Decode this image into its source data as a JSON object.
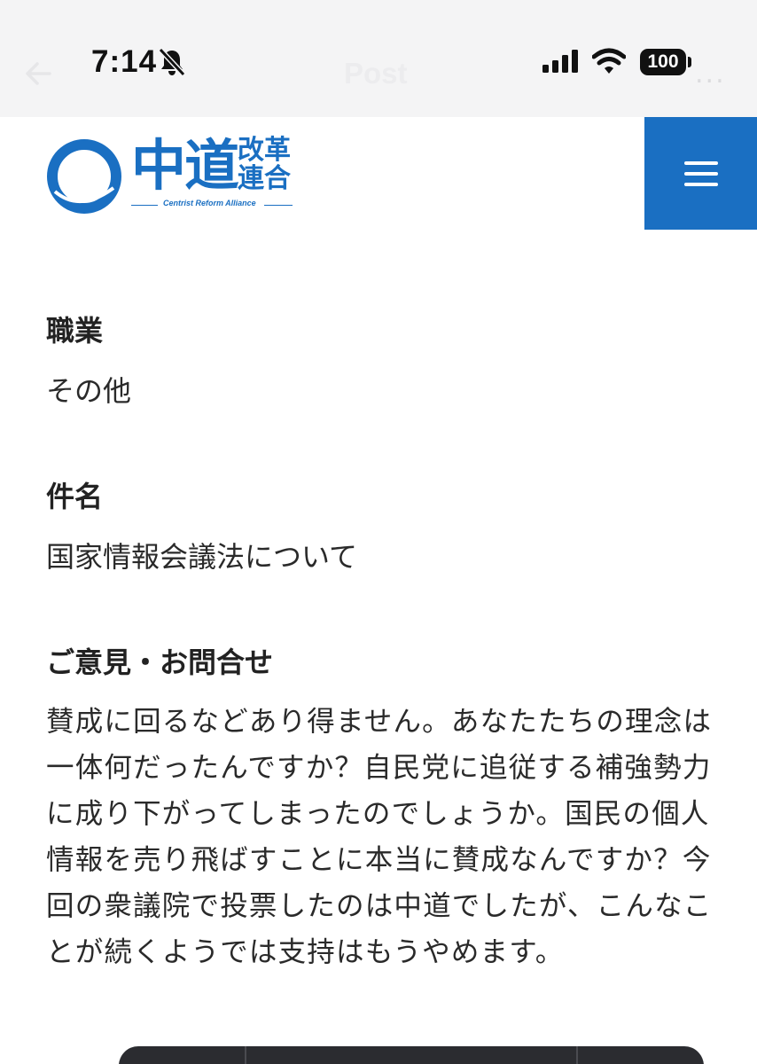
{
  "status_bar": {
    "time": "7:14",
    "battery": "100"
  },
  "app_header": {
    "title": "Post",
    "more": "..."
  },
  "site": {
    "logo_main": "中道",
    "logo_sub": "改革連合",
    "logo_english": "Centrist Reform Alliance",
    "brand_color": "#1a6fc2"
  },
  "form": {
    "occupation_label": "職業",
    "occupation_value": "その他",
    "subject_label": "件名",
    "subject_value": "国家情報会議法について",
    "message_label": "ご意見・お問合せ",
    "message_value": "賛成に回るなどあり得ません。あなたたちの理念は一体何だったんですか？自民党に追従する補強勢力に成り下がってしまったのでしょうか。国民の個人情報を売り飛ばすことに本当に賛成なんですか？今回の衆議院で投票したのは中道でしたが、こんなことが続くようでは支持はもうやめます。"
  }
}
